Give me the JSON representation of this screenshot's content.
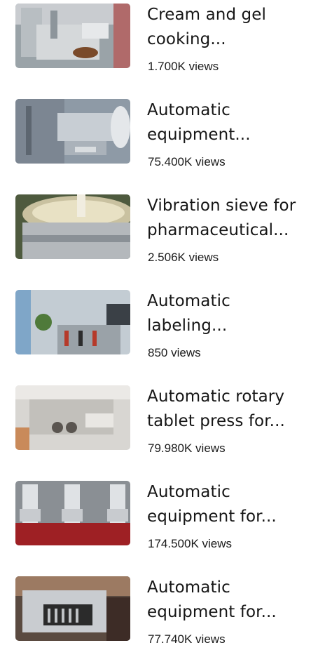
{
  "videos": [
    {
      "title_line1": "Cream and gel",
      "title_line2": "cooking...",
      "views": "1.700K views",
      "thumb": "cream-gel-cooking-machine"
    },
    {
      "title_line1": "Automatic",
      "title_line2": "equipment...",
      "views": "75.400K views",
      "thumb": "automatic-equipment"
    },
    {
      "title_line1": "Vibration sieve for",
      "title_line2": "pharmaceutical...",
      "views": "2.506K views",
      "thumb": "vibration-sieve"
    },
    {
      "title_line1": "Automatic",
      "title_line2": "labeling...",
      "views": "850 views",
      "thumb": "labeling-machine"
    },
    {
      "title_line1": "Automatic rotary",
      "title_line2": "tablet press for...",
      "views": "79.980K views",
      "thumb": "rotary-tablet-press"
    },
    {
      "title_line1": "Automatic",
      "title_line2": "equipment for...",
      "views": "174.500K views",
      "thumb": "vacuum-feeders"
    },
    {
      "title_line1": "Automatic",
      "title_line2": "equipment for...",
      "views": "77.740K views",
      "thumb": "counting-machine"
    }
  ],
  "colors": {
    "text": "#161616",
    "background": "#ffffff"
  }
}
